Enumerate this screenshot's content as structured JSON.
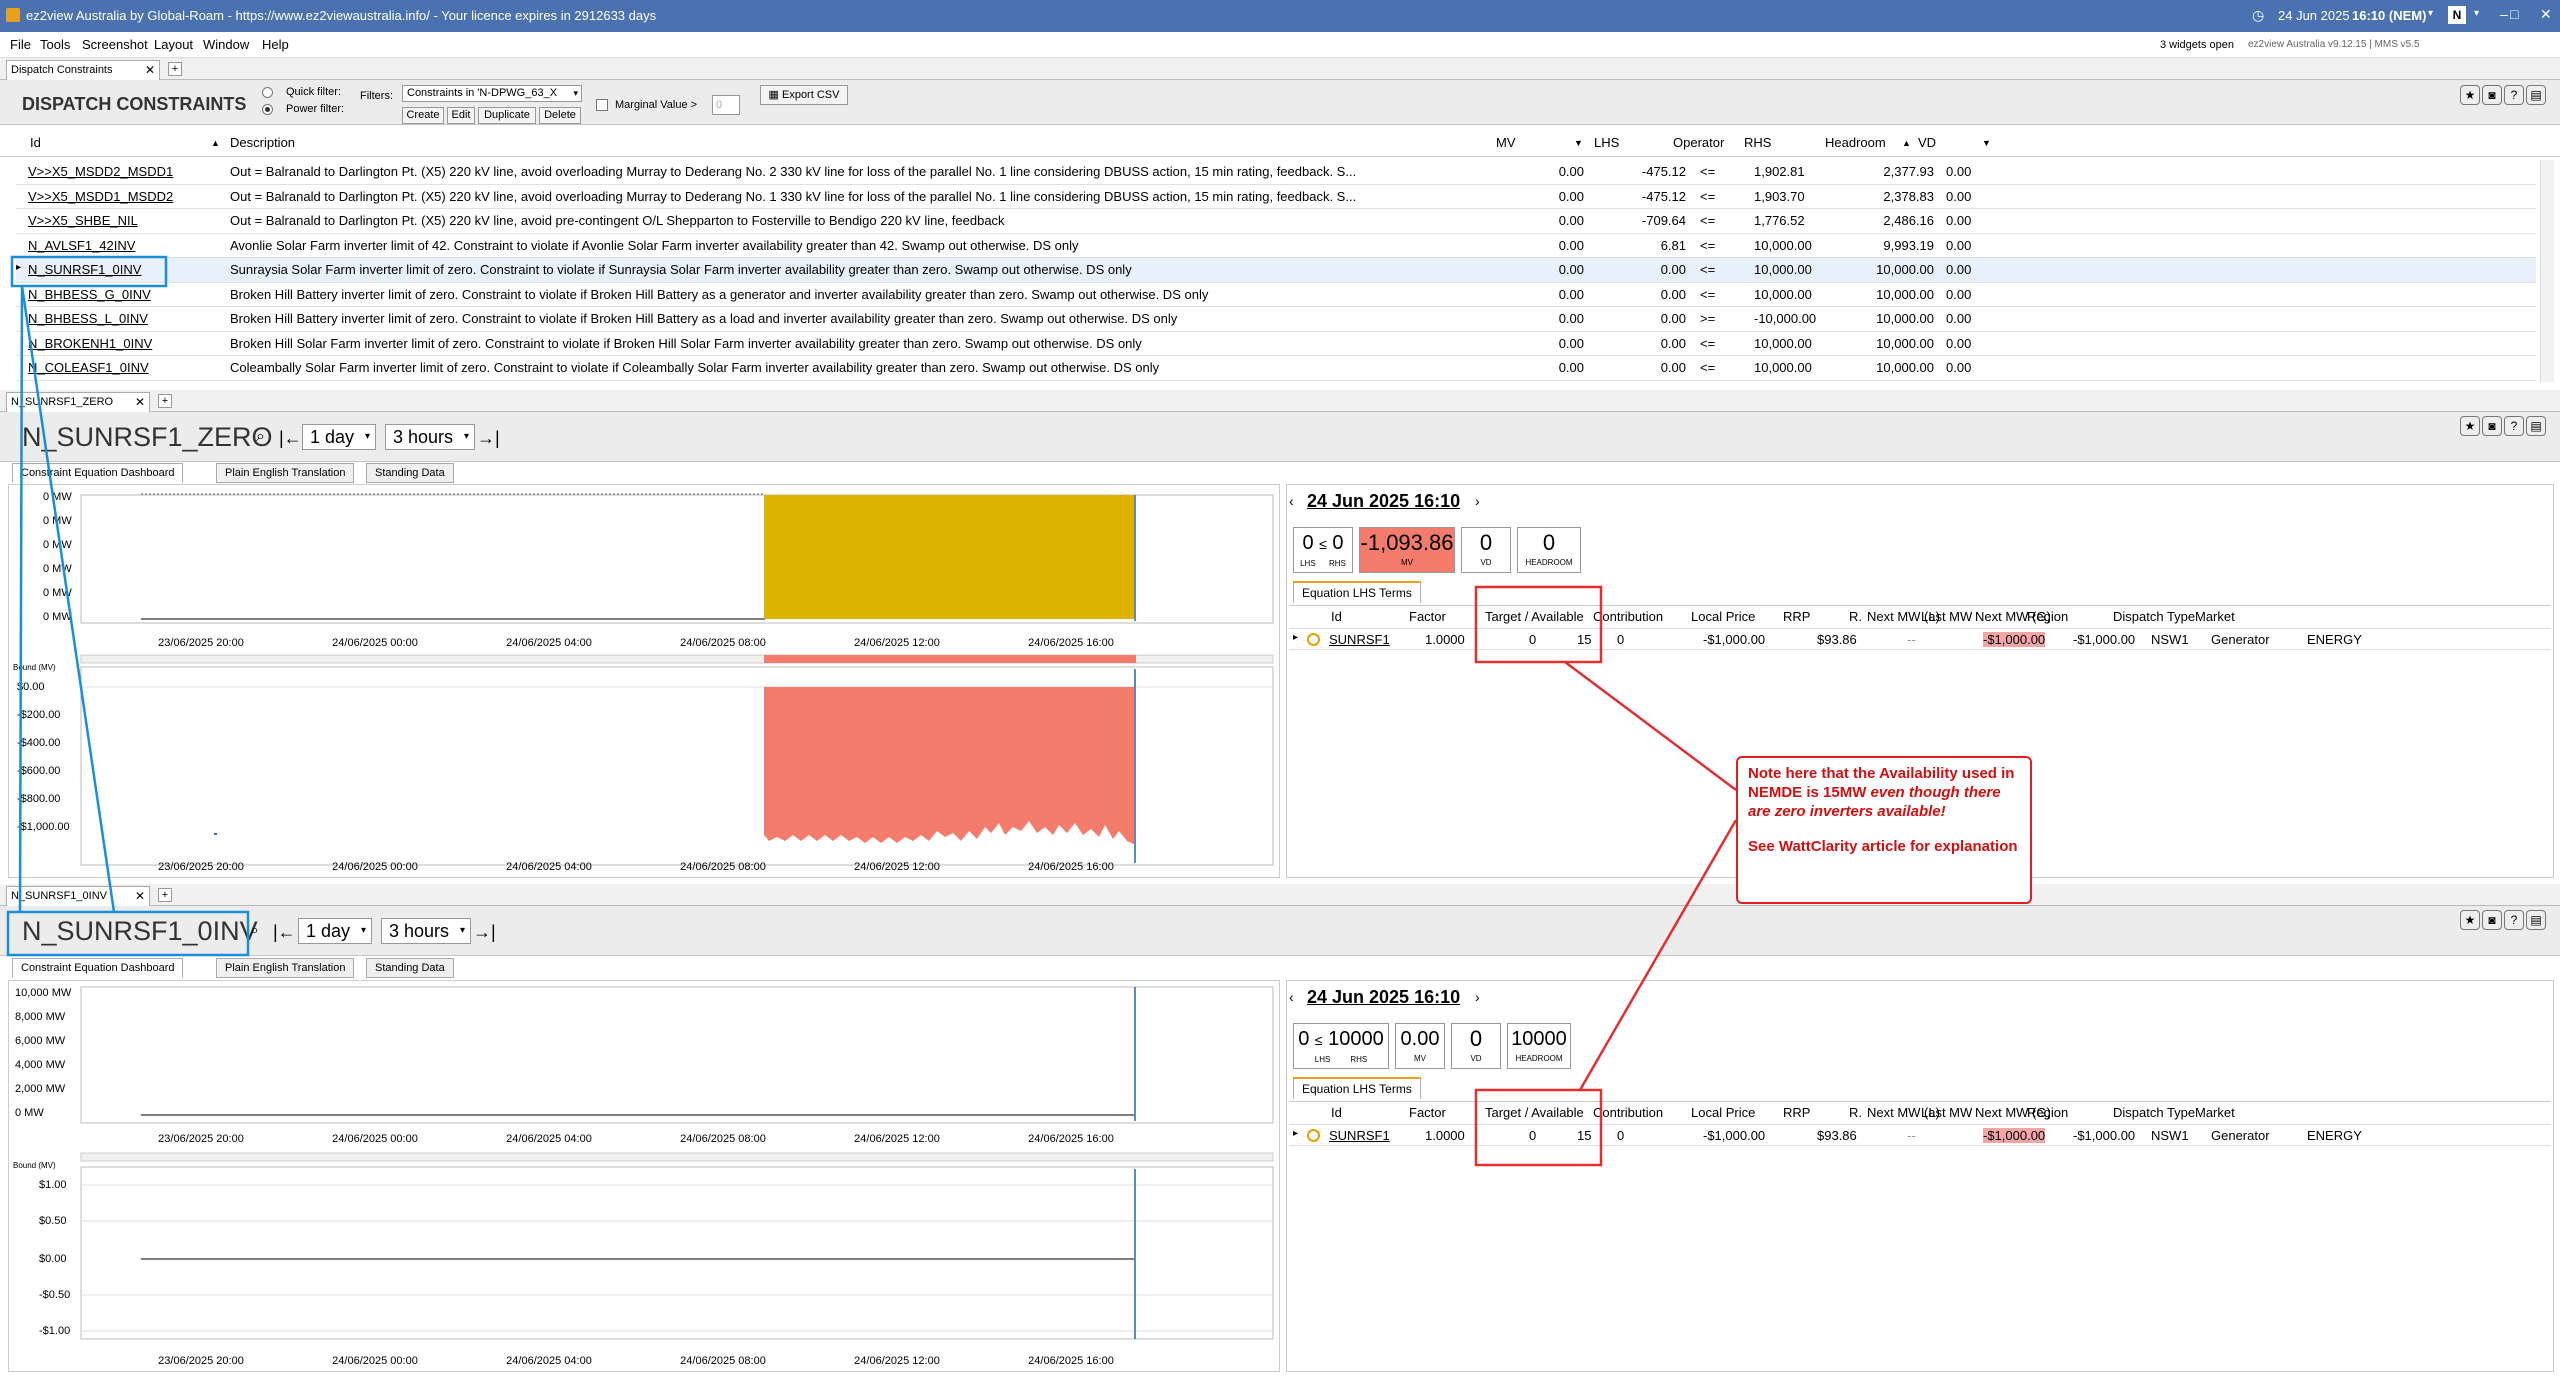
{
  "window": {
    "title": "ez2view Australia by Global-Roam - https://www.ez2viewaustralia.info/ - Your licence expires in 2912633 days",
    "datetime": "24 Jun 2025",
    "time": "16:10 (NEM)",
    "controls": [
      "–",
      "□",
      "✕"
    ]
  },
  "menu": {
    "items": [
      "File",
      "Tools",
      "Screenshot",
      "Layout",
      "Window",
      "Help"
    ],
    "widgets_open": "3 widgets open",
    "version": "ez2view Australia v9.12.15 | MMS v5.5"
  },
  "dispatch": {
    "tab": "Dispatch Constraints",
    "heading": "DISPATCH CONSTRAINTS",
    "quick_filter": "Quick filter:",
    "power_filter": "Power filter:",
    "filters_label": "Filters:",
    "filter_value": "Constraints in 'N-DPWG_63_X",
    "buttons": [
      "Create",
      "Edit",
      "Duplicate",
      "Delete"
    ],
    "marginal_label": "Marginal Value >",
    "marginal_value": "0",
    "export": "Export CSV",
    "columns": {
      "id": "Id",
      "description": "Description",
      "mv": "MV",
      "lhs": "LHS",
      "operator": "Operator",
      "rhs": "RHS",
      "headroom": "Headroom",
      "vd": "VD"
    },
    "rows": [
      {
        "id": "V>>X5_MSDD2_MSDD1",
        "description": "Out = Balranald to Darlington Pt. (X5) 220 kV line, avoid overloading Murray to Dederang No. 2 330 kV line for loss of the parallel No. 1 line considering DBUSS action, 15 min rating, feedback. S...",
        "mv": "0.00",
        "lhs": "-475.12",
        "op": "<=",
        "rhs": "1,902.81",
        "headroom": "2,377.93",
        "vd": "0.00"
      },
      {
        "id": "V>>X5_MSDD1_MSDD2",
        "description": "Out = Balranald to Darlington Pt. (X5) 220 kV line, avoid overloading Murray to Dederang No. 1 330 kV line for loss of the parallel No. 1 line considering DBUSS action, 15 min rating, feedback. S...",
        "mv": "0.00",
        "lhs": "-475.12",
        "op": "<=",
        "rhs": "1,903.70",
        "headroom": "2,378.83",
        "vd": "0.00"
      },
      {
        "id": "V>>X5_SHBE_NIL",
        "description": "Out = Balranald to Darlington Pt. (X5) 220 kV line, avoid pre-contingent O/L Shepparton to Fosterville to Bendigo 220 kV line, feedback",
        "mv": "0.00",
        "lhs": "-709.64",
        "op": "<=",
        "rhs": "1,776.52",
        "headroom": "2,486.16",
        "vd": "0.00"
      },
      {
        "id": "N_AVLSF1_42INV",
        "description": "Avonlie Solar Farm inverter limit of 42. Constraint to violate if Avonlie Solar Farm inverter availability greater than 42. Swamp out otherwise. DS only",
        "mv": "0.00",
        "lhs": "6.81",
        "op": "<=",
        "rhs": "10,000.00",
        "headroom": "9,993.19",
        "vd": "0.00"
      },
      {
        "id": "N_SUNRSF1_0INV",
        "description": "Sunraysia Solar Farm inverter limit of zero. Constraint to violate if Sunraysia Solar Farm inverter availability greater than zero. Swamp out otherwise. DS only",
        "mv": "0.00",
        "lhs": "0.00",
        "op": "<=",
        "rhs": "10,000.00",
        "headroom": "10,000.00",
        "vd": "0.00"
      },
      {
        "id": "N_BHBESS_G_0INV",
        "description": "Broken Hill Battery inverter limit of zero. Constraint to violate if Broken Hill Battery as a generator and inverter availability greater than zero. Swamp out otherwise. DS only",
        "mv": "0.00",
        "lhs": "0.00",
        "op": "<=",
        "rhs": "10,000.00",
        "headroom": "10,000.00",
        "vd": "0.00"
      },
      {
        "id": "N_BHBESS_L_0INV",
        "description": "Broken Hill Battery inverter limit of zero. Constraint to violate if Broken Hill Battery as a load and inverter availability greater than zero. Swamp out otherwise. DS only",
        "mv": "0.00",
        "lhs": "0.00",
        "op": ">=",
        "rhs": "-10,000.00",
        "headroom": "10,000.00",
        "vd": "0.00"
      },
      {
        "id": "N_BROKENH1_0INV",
        "description": "Broken Hill Solar Farm inverter limit of zero. Constraint to violate if Broken Hill Solar Farm inverter availability greater than zero. Swamp out otherwise. DS only",
        "mv": "0.00",
        "lhs": "0.00",
        "op": "<=",
        "rhs": "10,000.00",
        "headroom": "10,000.00",
        "vd": "0.00"
      },
      {
        "id": "N_COLEASF1_0INV",
        "description": "Coleambally Solar Farm inverter limit of zero. Constraint to violate if Coleambally Solar Farm inverter availability greater than zero. Swamp out otherwise. DS only",
        "mv": "0.00",
        "lhs": "0.00",
        "op": "<=",
        "rhs": "10,000.00",
        "headroom": "10,000.00",
        "vd": "0.00"
      }
    ]
  },
  "panel1": {
    "tab": "N_SUNRSF1_ZERO",
    "title": "N_SUNRSF1_ZERO",
    "range1": "1 day",
    "range2": "3 hours",
    "subtabs": [
      "Constraint Equation Dashboard",
      "Plain English Translation",
      "Standing Data"
    ],
    "yticks_top": [
      "0 MW",
      "0 MW",
      "0 MW",
      "0 MW",
      "0 MW",
      "0 MW"
    ],
    "bound_label": "Bound (MV)",
    "yticks_bottom": [
      "$0.00",
      "-$200.00",
      "-$400.00",
      "-$600.00",
      "-$800.00",
      "-$1,000.00"
    ],
    "xticks": [
      "23/06/2025 20:00",
      "24/06/2025 00:00",
      "24/06/2025 04:00",
      "24/06/2025 08:00",
      "24/06/2025 12:00",
      "24/06/2025 16:00"
    ],
    "datetime": "24 Jun 2025 16:10",
    "lhs": "0",
    "op": "≤",
    "rhs": "0",
    "mv": "-1,093.86",
    "vd": "0",
    "headroom": "0",
    "labels": {
      "lhs": "LHS",
      "rhs": "RHS",
      "mv": "MV",
      "vd": "VD",
      "headroom": "HEADROOM"
    },
    "lhs_tab": "Equation LHS Terms",
    "grid_row": {
      "id": "SUNRSF1",
      "factor": "1.0000",
      "target": "0",
      "available": "15",
      "contribution": "0",
      "local_price": "-$1,000.00",
      "rrp": "$93.86",
      "r": "",
      "next_mw_l": "--",
      "last_mw": "-$1,000.00",
      "next_mw_g": "-$1,000.00",
      "region": "NSW1",
      "dispatch_type": "Generator",
      "market": "ENERGY"
    }
  },
  "panel2": {
    "tab": "N_SUNRSF1_0INV",
    "title": "N_SUNRSF1_0INV",
    "range1": "1 day",
    "range2": "3 hours",
    "subtabs": [
      "Constraint Equation Dashboard",
      "Plain English Translation",
      "Standing Data"
    ],
    "yticks_top": [
      "10,000 MW",
      "8,000 MW",
      "6,000 MW",
      "4,000 MW",
      "2,000 MW",
      "0 MW"
    ],
    "bound_label": "Bound (MV)",
    "yticks_bottom": [
      "$1.00",
      "$0.50",
      "$0.00",
      "-$0.50",
      "-$1.00"
    ],
    "xticks": [
      "23/06/2025 20:00",
      "24/06/2025 00:00",
      "24/06/2025 04:00",
      "24/06/2025 08:00",
      "24/06/2025 12:00",
      "24/06/2025 16:00"
    ],
    "datetime": "24 Jun 2025 16:10",
    "lhs": "0",
    "op": "≤",
    "rhs": "10000",
    "mv": "0.00",
    "vd": "0",
    "headroom": "10000",
    "labels": {
      "lhs": "LHS",
      "rhs": "RHS",
      "mv": "MV",
      "vd": "VD",
      "headroom": "HEADROOM"
    },
    "lhs_tab": "Equation LHS Terms",
    "grid_row": {
      "id": "SUNRSF1",
      "factor": "1.0000",
      "target": "0",
      "available": "15",
      "contribution": "0",
      "local_price": "-$1,000.00",
      "rrp": "$93.86",
      "r": "",
      "next_mw_l": "--",
      "last_mw": "-$1,000.00",
      "next_mw_g": "-$1,000.00",
      "region": "NSW1",
      "dispatch_type": "Generator",
      "market": "ENERGY"
    }
  },
  "grid_columns": [
    "Id",
    "Factor",
    "Target / Available",
    "Contribution",
    "Local Price",
    "RRP",
    "R.",
    "Next MW (L)",
    "Last MW",
    "Next MW (G)",
    "Region",
    "Dispatch Type",
    "Market"
  ],
  "callout": {
    "line1": "Note here that the Availability used in NEMDE is 15MW",
    "line1_italic": "even though there are zero inverters available!",
    "line2": "See WattClarity article for explanation"
  },
  "colors": {
    "titlebar": "#4a72b0",
    "yellow_fill": "#dcb400",
    "salmon_fill": "#f47c6c",
    "highlight_red": "#e03030",
    "annotation_blue": "#1a8fd8"
  },
  "icons": [
    "star-icon",
    "camera-icon",
    "help-icon",
    "comment-icon"
  ]
}
